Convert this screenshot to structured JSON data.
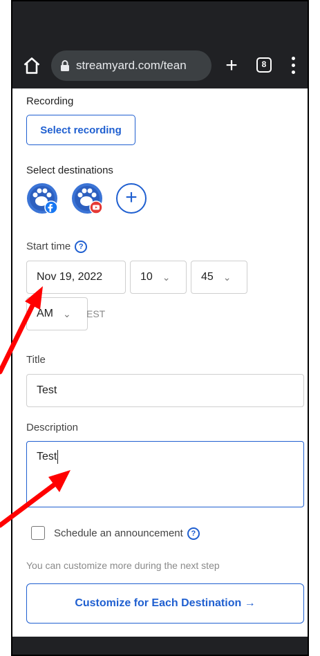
{
  "browser": {
    "url": "streamyard.com/tean",
    "tab_count": "8"
  },
  "recording": {
    "label": "Recording",
    "button": "Select recording"
  },
  "destinations": {
    "label": "Select destinations",
    "items": [
      {
        "icon": "facebook-destination-icon"
      },
      {
        "icon": "youtube-destination-icon"
      }
    ],
    "add_label": "+"
  },
  "start_time": {
    "label": "Start time",
    "help": "?",
    "date": "Nov 19, 2022",
    "hour": "10",
    "minute": "45",
    "ampm": "AM",
    "timezone": "EST",
    "caret": "⌄"
  },
  "title": {
    "label": "Title",
    "value": "Test"
  },
  "description": {
    "label": "Description",
    "value": "Test"
  },
  "announcement": {
    "label": "Schedule an announcement",
    "help": "?"
  },
  "hint": "You can customize more during the next step",
  "customize_button": "Customize for Each Destination →",
  "colors": {
    "accent": "#1f5fd0",
    "annotation_arrow": "#ff0000",
    "browser_bar": "#202124"
  }
}
